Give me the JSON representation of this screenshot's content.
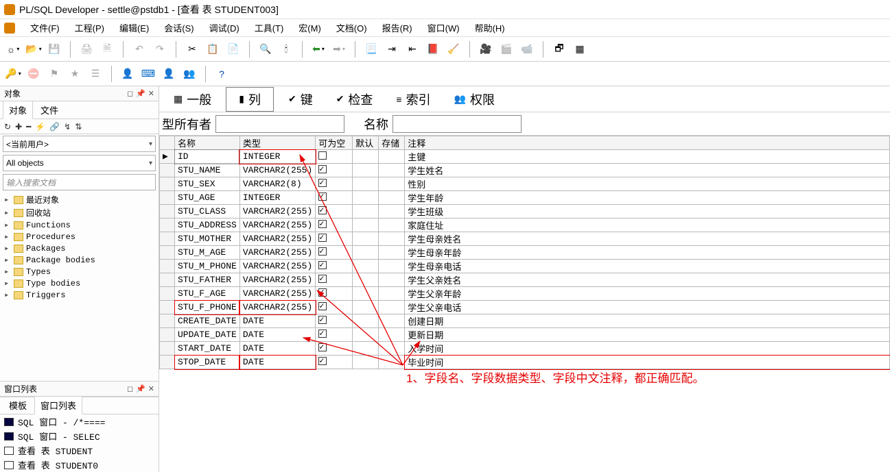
{
  "title": "PL/SQL Developer - settle@pstdb1 - [查看 表 STUDENT003]",
  "menu": [
    "文件(F)",
    "工程(P)",
    "编辑(E)",
    "会话(S)",
    "调试(D)",
    "工具(T)",
    "宏(M)",
    "文档(O)",
    "报告(R)",
    "窗口(W)",
    "帮助(H)"
  ],
  "toolbar1_groups": [
    [
      {
        "name": "new-icon",
        "glyph": "☼",
        "drop": true
      },
      {
        "name": "open-icon",
        "glyph": "📂",
        "drop": true
      },
      {
        "name": "save-icon",
        "glyph": "💾",
        "disabled": true
      }
    ],
    [
      {
        "name": "print-icon",
        "glyph": "🖨",
        "disabled": true
      },
      {
        "name": "print-preview-icon",
        "glyph": "🗎",
        "disabled": true
      }
    ],
    [
      {
        "name": "undo-icon",
        "glyph": "↶",
        "disabled": true
      },
      {
        "name": "redo-icon",
        "glyph": "↷",
        "disabled": true
      }
    ],
    [
      {
        "name": "cut-icon",
        "glyph": "✂"
      },
      {
        "name": "copy-icon",
        "glyph": "📋"
      },
      {
        "name": "paste-icon",
        "glyph": "📄"
      }
    ],
    [
      {
        "name": "find-icon",
        "glyph": "🔍"
      },
      {
        "name": "find-next-icon",
        "glyph": "🕯"
      }
    ],
    [
      {
        "name": "back-icon",
        "glyph": "⬅",
        "drop": true,
        "color": "#2a8c2a"
      },
      {
        "name": "forward-icon",
        "glyph": "➡",
        "drop": true,
        "disabled": true
      }
    ],
    [
      {
        "name": "page-icon",
        "glyph": "📃"
      },
      {
        "name": "indent-icon",
        "glyph": "⇥"
      },
      {
        "name": "outdent-icon",
        "glyph": "⇤"
      },
      {
        "name": "doc-icon",
        "glyph": "📕"
      },
      {
        "name": "clean-icon",
        "glyph": "🧹"
      }
    ],
    [
      {
        "name": "cam1-icon",
        "glyph": "🎥"
      },
      {
        "name": "cam2-icon",
        "glyph": "🎬",
        "disabled": true
      },
      {
        "name": "cam3-icon",
        "glyph": "📹",
        "disabled": true
      }
    ],
    [
      {
        "name": "windows-icon",
        "glyph": "🗗"
      },
      {
        "name": "grid-icon",
        "glyph": "▦"
      }
    ]
  ],
  "toolbar2_groups": [
    [
      {
        "name": "key-icon",
        "glyph": "🔑",
        "drop": true,
        "color": "#c9a81e"
      },
      {
        "name": "filter-icon",
        "glyph": "⛔",
        "disabled": true
      },
      {
        "name": "flag-icon",
        "glyph": "⚑",
        "disabled": true
      },
      {
        "name": "star-icon",
        "glyph": "★",
        "disabled": true
      },
      {
        "name": "list-icon",
        "glyph": "☰",
        "disabled": true
      }
    ],
    [
      {
        "name": "user-cyan-icon",
        "glyph": "👤",
        "color": "#00a8a8"
      },
      {
        "name": "sql-icon",
        "glyph": "⌨",
        "color": "#0068c9"
      },
      {
        "name": "user-red-icon",
        "glyph": "👤",
        "color": "#cc3333"
      },
      {
        "name": "user-check-icon",
        "glyph": "👥",
        "color": "#2a8c2a"
      }
    ],
    [
      {
        "name": "help-icon",
        "glyph": "?",
        "color": "#0047ab"
      }
    ]
  ],
  "sidebar": {
    "objects_title": "对象",
    "tabs": [
      "对象",
      "文件"
    ],
    "mini_icons": [
      "↻",
      "✚",
      "━",
      "⚡",
      "🔗",
      "↯",
      "⇅"
    ],
    "user_combo": "<当前用户>",
    "filter_combo": "All objects",
    "search_placeholder": "输入搜索文档",
    "tree": [
      "最近对象",
      "回收站",
      "Functions",
      "Procedures",
      "Packages",
      "Package bodies",
      "Types",
      "Type bodies",
      "Triggers"
    ],
    "winlist_title": "窗口列表",
    "winlist_tabs": [
      "模板",
      "窗口列表"
    ],
    "winlist_items": [
      {
        "dark": true,
        "text": "SQL 窗口 - /*===="
      },
      {
        "dark": true,
        "text": "SQL 窗口 - SELEC"
      },
      {
        "dark": false,
        "text": "查看 表 STUDENT"
      },
      {
        "dark": false,
        "text": "查看 表 STUDENT0"
      }
    ]
  },
  "content": {
    "tabs": [
      {
        "icon": "▦",
        "label": "一般"
      },
      {
        "icon": "▮",
        "label": "列"
      },
      {
        "icon": "✔",
        "label": "键"
      },
      {
        "icon": "✔",
        "label": "检查"
      },
      {
        "icon": "≡",
        "label": "索引"
      },
      {
        "icon": "👥",
        "label": "权限"
      }
    ],
    "active_tab_index": 1,
    "form": {
      "owner_label": "型所有者",
      "name_label": "名称"
    },
    "columns_header": [
      "名称",
      "类型",
      "可为空",
      "默认",
      "存储",
      "注释"
    ],
    "rows": [
      {
        "sel": true,
        "name": "ID",
        "type": "INTEGER",
        "null": false,
        "comment": "主键",
        "hi": "row"
      },
      {
        "name": "STU_NAME",
        "type": "VARCHAR2(255)",
        "null": true,
        "comment": "学生姓名"
      },
      {
        "name": "STU_SEX",
        "type": "VARCHAR2(8)",
        "null": true,
        "comment": "性别"
      },
      {
        "name": "STU_AGE",
        "type": "INTEGER",
        "null": true,
        "comment": "学生年龄"
      },
      {
        "name": "STU_CLASS",
        "type": "VARCHAR2(255)",
        "null": true,
        "comment": "学生班级"
      },
      {
        "name": "STU_ADDRESS",
        "type": "VARCHAR2(255)",
        "null": true,
        "comment": "家庭住址"
      },
      {
        "name": "STU_MOTHER",
        "type": "VARCHAR2(255)",
        "null": true,
        "comment": "学生母亲姓名"
      },
      {
        "name": "STU_M_AGE",
        "type": "VARCHAR2(255)",
        "null": true,
        "comment": "学生母亲年龄"
      },
      {
        "name": "STU_M_PHONE",
        "type": "VARCHAR2(255)",
        "null": true,
        "comment": "学生母亲电话"
      },
      {
        "name": "STU_FATHER",
        "type": "VARCHAR2(255)",
        "null": true,
        "comment": "学生父亲姓名"
      },
      {
        "name": "STU_F_AGE",
        "type": "VARCHAR2(255)",
        "null": true,
        "comment": "学生父亲年龄"
      },
      {
        "name": "STU_F_PHONE",
        "type": "VARCHAR2(255)",
        "null": true,
        "comment": "学生父亲电话",
        "hi": "row"
      },
      {
        "name": "CREATE_DATE",
        "type": "DATE",
        "null": true,
        "comment": "创建日期"
      },
      {
        "name": "UPDATE_DATE",
        "type": "DATE",
        "null": true,
        "comment": "更新日期"
      },
      {
        "name": "START_DATE",
        "type": "DATE",
        "null": true,
        "comment": "入学时间"
      },
      {
        "name": "STOP_DATE",
        "type": "DATE",
        "null": true,
        "comment": "毕业时间",
        "hi": "split"
      }
    ],
    "annotation": "1、字段名、字段数据类型、字段中文注释，都正确匹配。"
  }
}
